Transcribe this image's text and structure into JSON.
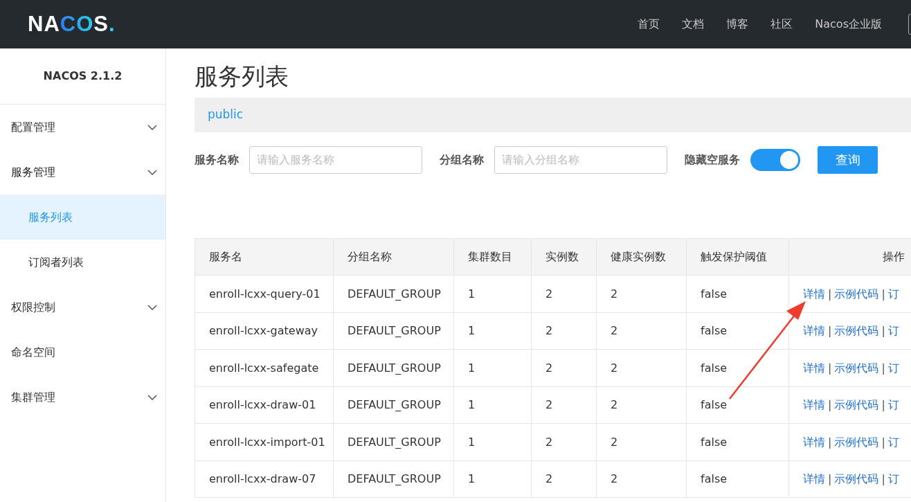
{
  "header": {
    "logo": "NACOS.",
    "nav": [
      "首页",
      "文档",
      "博客",
      "社区",
      "Nacos企业版"
    ]
  },
  "sidebar": {
    "title": "NACOS 2.1.2",
    "items": [
      {
        "label": "配置管理",
        "expanded": false
      },
      {
        "label": "服务管理",
        "expanded": true,
        "children": [
          {
            "label": "服务列表",
            "selected": true
          },
          {
            "label": "订阅者列表",
            "selected": false
          }
        ]
      },
      {
        "label": "权限控制",
        "expanded": false
      },
      {
        "label": "命名空间"
      },
      {
        "label": "集群管理",
        "expanded": false
      }
    ]
  },
  "page_title": "服务列表",
  "namespaces": [
    {
      "label": "public",
      "selected": true
    }
  ],
  "filters": [
    {
      "label": "服务名称",
      "placeholder": "请输入服务名称"
    },
    {
      "label": "分组名称",
      "placeholder": "请输入分组名称"
    }
  ],
  "hide_empty": {
    "label": "隐藏空服务",
    "on": true
  },
  "query_button": "查询",
  "table": {
    "separator": "|",
    "columns": [
      "服务名",
      "分组名称",
      "集群数目",
      "实例数",
      "健康实例数",
      "触发保护阈值",
      "操作"
    ],
    "rows": [
      {
        "cells": [
          "enroll-lcxx-query-01",
          "DEFAULT_GROUP",
          "1",
          "2",
          "2",
          "false"
        ],
        "actions": [
          "详情",
          "示例代码",
          "订"
        ]
      },
      {
        "cells": [
          "enroll-lcxx-gateway",
          "DEFAULT_GROUP",
          "1",
          "2",
          "2",
          "false"
        ],
        "actions": [
          "详情",
          "示例代码",
          "订"
        ]
      },
      {
        "cells": [
          "enroll-lcxx-safegate",
          "DEFAULT_GROUP",
          "1",
          "2",
          "2",
          "false"
        ],
        "actions": [
          "详情",
          "示例代码",
          "订"
        ]
      },
      {
        "cells": [
          "enroll-lcxx-draw-01",
          "DEFAULT_GROUP",
          "1",
          "2",
          "2",
          "false"
        ],
        "actions": [
          "详情",
          "示例代码",
          "订"
        ]
      },
      {
        "cells": [
          "enroll-lcxx-import-01",
          "DEFAULT_GROUP",
          "1",
          "2",
          "2",
          "false"
        ],
        "actions": [
          "详情",
          "示例代码",
          "订"
        ]
      },
      {
        "cells": [
          "enroll-lcxx-draw-07",
          "DEFAULT_GROUP",
          "1",
          "2",
          "2",
          "false"
        ],
        "actions": [
          "详情",
          "示例代码",
          "订"
        ]
      }
    ]
  },
  "annotations": [
    {
      "kind": "arrow"
    }
  ]
}
